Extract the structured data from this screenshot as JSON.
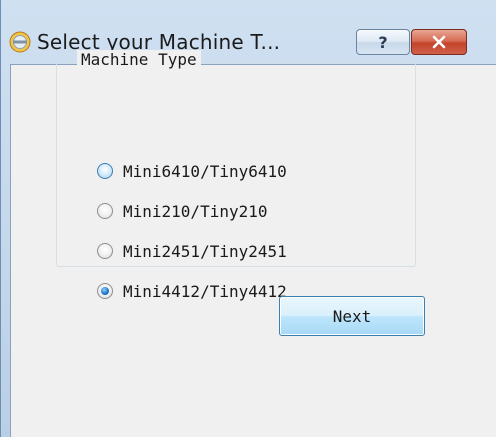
{
  "window": {
    "title": "Select your Machine T...",
    "help_label": "?",
    "close_label": "✕"
  },
  "group": {
    "title": "Machine Type",
    "options": [
      {
        "label": "Mini6410/Tiny6410",
        "state": "hover"
      },
      {
        "label": "Mini210/Tiny210",
        "state": "normal"
      },
      {
        "label": "Mini2451/Tiny2451",
        "state": "normal"
      },
      {
        "label": "Mini4412/Tiny4412",
        "state": "checked"
      }
    ]
  },
  "actions": {
    "next_label": "Next"
  }
}
